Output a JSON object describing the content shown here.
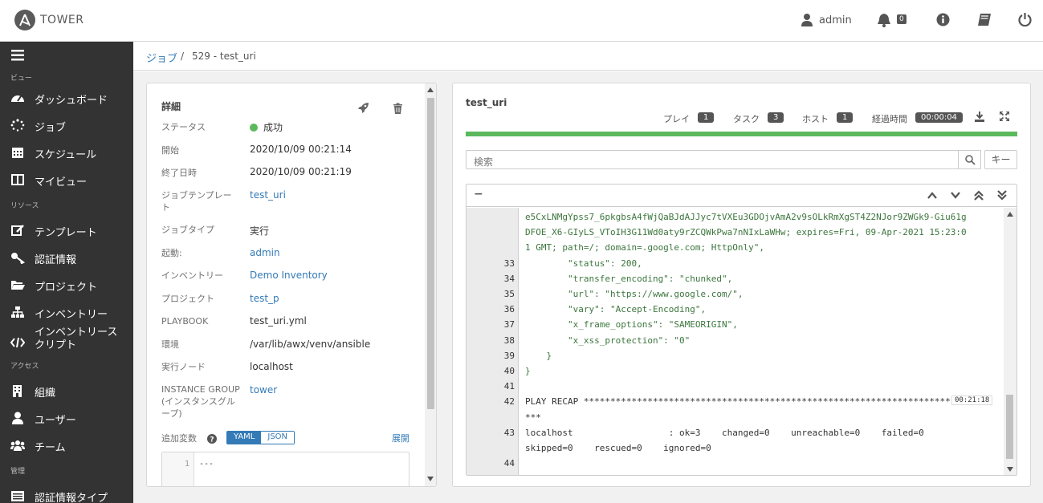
{
  "header": {
    "brand": "TOWER",
    "user": "admin",
    "notification_count": "0"
  },
  "sidebar": {
    "sections": [
      "ビュー",
      "リソース",
      "アクセス",
      "管理"
    ],
    "items": [
      {
        "label": "ダッシュボード",
        "icon": "dashboard-icon"
      },
      {
        "label": "ジョブ",
        "icon": "jobs-spinner-icon"
      },
      {
        "label": "スケジュール",
        "icon": "calendar-icon"
      },
      {
        "label": "マイビュー",
        "icon": "columns-icon"
      },
      {
        "label": "テンプレート",
        "icon": "edit-icon"
      },
      {
        "label": "認証情報",
        "icon": "key-icon"
      },
      {
        "label": "プロジェクト",
        "icon": "folder-icon"
      },
      {
        "label": "インベントリー",
        "icon": "sitemap-icon"
      },
      {
        "label": "インベントリースクリプト",
        "icon": "code-icon"
      },
      {
        "label": "組織",
        "icon": "building-icon"
      },
      {
        "label": "ユーザー",
        "icon": "user-icon"
      },
      {
        "label": "チーム",
        "icon": "users-icon"
      },
      {
        "label": "認証情報タイプ",
        "icon": "list-icon"
      }
    ]
  },
  "breadcrumb": {
    "parent": "ジョブ",
    "separator": "/",
    "current": "529 - test_uri"
  },
  "details": {
    "title": "詳細",
    "rows": [
      {
        "label": "ステータス",
        "value": "成功"
      },
      {
        "label": "開始",
        "value": "2020/10/09 00:21:14"
      },
      {
        "label": "終了日時",
        "value": "2020/10/09 00:21:19"
      },
      {
        "label": "ジョブテンプレート",
        "value": "test_uri"
      },
      {
        "label": "ジョブタイプ",
        "value": "実行"
      },
      {
        "label": "起動:",
        "value": "admin"
      },
      {
        "label": "インベントリー",
        "value": "Demo Inventory"
      },
      {
        "label": "プロジェクト",
        "value": "test_p"
      },
      {
        "label": "PLAYBOOK",
        "value": "test_uri.yml"
      },
      {
        "label": "環境",
        "value": "/var/lib/awx/venv/ansible"
      },
      {
        "label": "実行ノード",
        "value": "localhost"
      },
      {
        "label": "INSTANCE GROUP (インスタンスグループ)",
        "value": "tower"
      }
    ],
    "extra_vars_label": "追加変数",
    "yaml_label": "YAML",
    "json_label": "JSON",
    "expand_label": "展開",
    "editor_line": "1",
    "editor_code": "---"
  },
  "output": {
    "title": "test_uri",
    "plays_label": "プレイ",
    "plays": "1",
    "tasks_label": "タスク",
    "tasks": "3",
    "hosts_label": "ホスト",
    "hosts": "1",
    "elapsed_label": "経過時間",
    "elapsed": "00:00:04",
    "search_placeholder": "検索",
    "key_label": "キー",
    "collapse": "−",
    "timestamp": "00:21:18",
    "lines": [
      {
        "no": "",
        "text": "e5CxLNMgYpss7_6pkgbsA4fWjQaBJdAJJyc7tVXEu3GDOjvAmA2v9sOLkRmXgST4Z2NJor9ZWGk9-Giu61g",
        "green": true
      },
      {
        "no": "",
        "text": "DFOE_X6-GIyLS_VToIH3G11Wd0aty9rZCQWkPwa7nNIxLaWHw; expires=Fri, 09-Apr-2021 15:23:0",
        "green": true
      },
      {
        "no": "",
        "text": "1 GMT; path=/; domain=.google.com; HttpOnly\",",
        "green": true
      },
      {
        "no": "33",
        "text": "        \"status\": 200,",
        "green": true
      },
      {
        "no": "34",
        "text": "        \"transfer_encoding\": \"chunked\",",
        "green": true
      },
      {
        "no": "35",
        "text": "        \"url\": \"https://www.google.com/\",",
        "green": true
      },
      {
        "no": "36",
        "text": "        \"vary\": \"Accept-Encoding\",",
        "green": true
      },
      {
        "no": "37",
        "text": "        \"x_frame_options\": \"SAMEORIGIN\",",
        "green": true
      },
      {
        "no": "38",
        "text": "        \"x_xss_protection\": \"0\"",
        "green": true
      },
      {
        "no": "39",
        "text": "    }",
        "green": true
      },
      {
        "no": "40",
        "text": "}",
        "green": true
      },
      {
        "no": "41",
        "text": "",
        "green": false
      },
      {
        "no": "42",
        "text": "PLAY RECAP *********************************************************************",
        "green": false
      },
      {
        "no": "",
        "text": "***",
        "green": false
      },
      {
        "no": "43",
        "text": "localhost                  : ok=3    changed=0    unreachable=0    failed=0",
        "green": false
      },
      {
        "no": "",
        "text": "skipped=0    rescued=0    ignored=0",
        "green": false
      },
      {
        "no": "44",
        "text": "",
        "green": false
      }
    ]
  }
}
